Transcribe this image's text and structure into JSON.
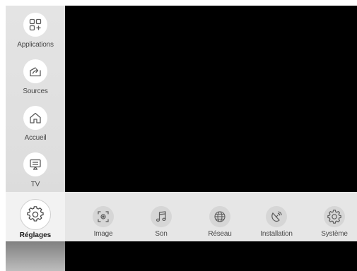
{
  "sidebar": {
    "items": [
      {
        "label": "Applications",
        "icon": "apps-icon"
      },
      {
        "label": "Sources",
        "icon": "sources-icon"
      },
      {
        "label": "Accueil",
        "icon": "home-icon"
      },
      {
        "label": "TV",
        "icon": "tv-icon"
      }
    ],
    "active": {
      "label": "Réglages",
      "icon": "gear-icon"
    }
  },
  "settings": {
    "items": [
      {
        "label": "Image",
        "icon": "picture-icon"
      },
      {
        "label": "Son",
        "icon": "music-note-icon"
      },
      {
        "label": "Réseau",
        "icon": "globe-icon"
      },
      {
        "label": "Installation",
        "icon": "satellite-dish-icon"
      },
      {
        "label": "Système",
        "icon": "system-gear-icon"
      }
    ]
  },
  "colors": {
    "screen": "#000000",
    "sidebar": "#e0e0e0",
    "settings_bar": "#e6e6e6",
    "icon_stroke": "#5a5a5a"
  }
}
